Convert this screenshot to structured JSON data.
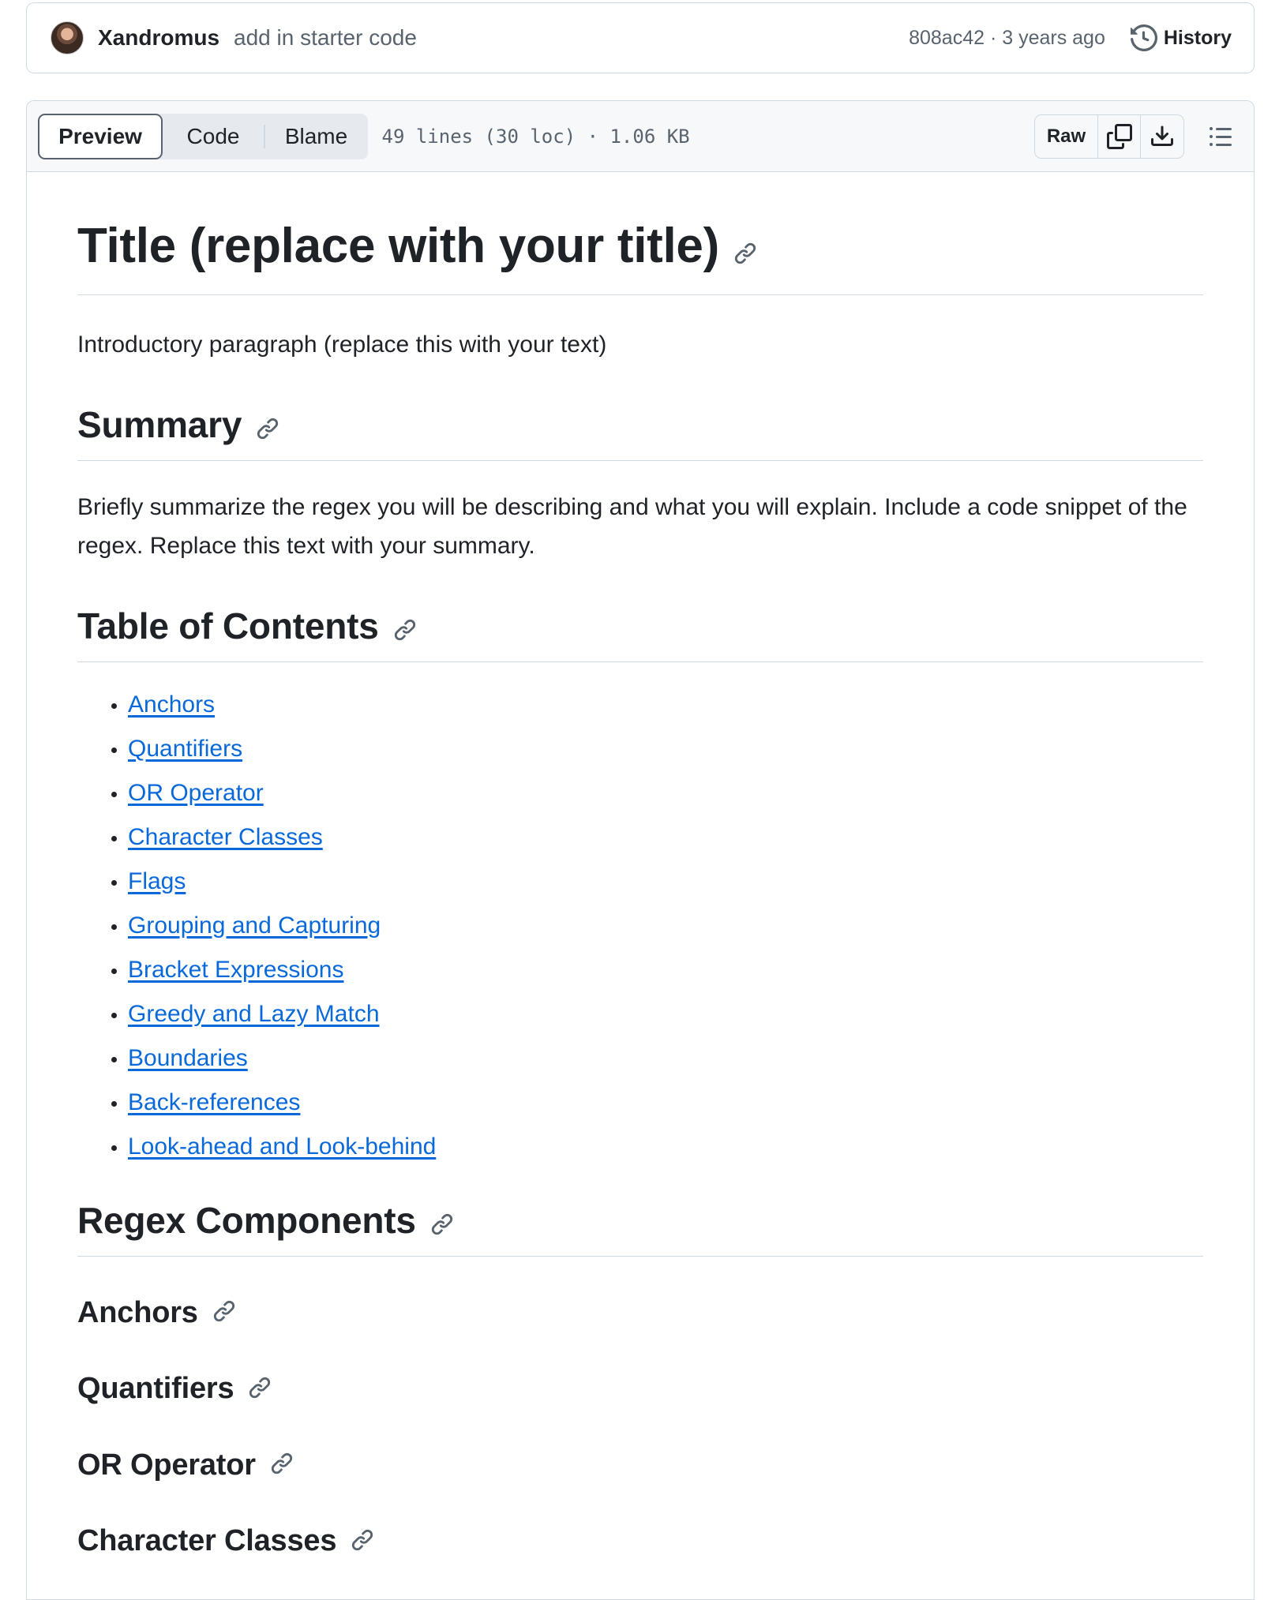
{
  "commit": {
    "author": "Xandromus",
    "message": "add in starter code",
    "meta": "808ac42 · 3 years ago",
    "history_label": "History"
  },
  "file_header": {
    "tabs": [
      {
        "label": "Preview",
        "active": true
      },
      {
        "label": "Code",
        "active": false
      },
      {
        "label": "Blame",
        "active": false
      }
    ],
    "file_info": "49 lines (30 loc) · 1.06 KB",
    "raw_label": "Raw",
    "icons": [
      "copy-icon",
      "download-icon",
      "list-unordered-icon"
    ]
  },
  "markdown": {
    "title": "Title (replace with your title)",
    "intro": "Introductory paragraph (replace this with your text)",
    "summary_heading": "Summary",
    "summary_text": "Briefly summarize the regex you will be describing and what you will explain. Include a code snippet of the regex. Replace this text with your summary.",
    "toc_heading": "Table of Contents",
    "toc_items": [
      "Anchors",
      "Quantifiers",
      "OR Operator",
      "Character Classes",
      "Flags",
      "Grouping and Capturing",
      "Bracket Expressions",
      "Greedy and Lazy Match",
      "Boundaries",
      "Back-references",
      "Look-ahead and Look-behind"
    ],
    "components_heading": "Regex Components",
    "components": [
      "Anchors",
      "Quantifiers",
      "OR Operator",
      "Character Classes"
    ]
  },
  "colors": {
    "link": "#0969da",
    "text": "#1f2328",
    "muted": "#59636e",
    "border": "#d1d9e0"
  }
}
